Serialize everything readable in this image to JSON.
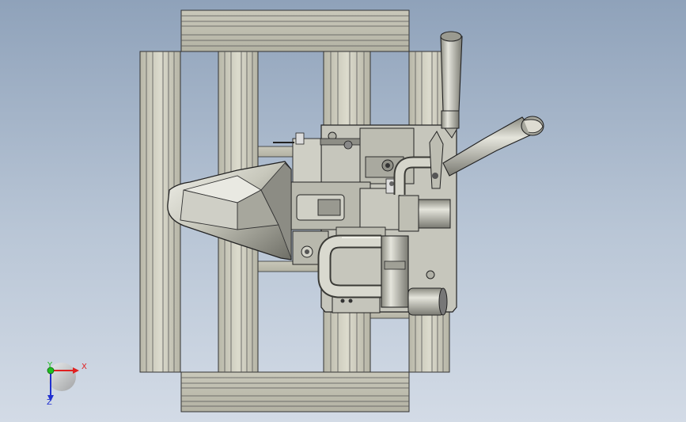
{
  "view": {
    "background_top": "#8fa2ba",
    "background_bottom": "#d3dbe6"
  },
  "triad": {
    "x_label": "X",
    "y_label": "Y",
    "z_label": "Z",
    "x_color": "#e02020",
    "y_color": "#20c020",
    "z_color": "#2030d0"
  }
}
